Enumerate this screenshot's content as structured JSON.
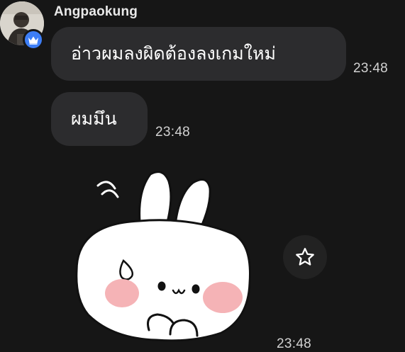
{
  "sender": {
    "name": "Angpaokung",
    "badge_icon": "crown-icon",
    "badge_color": "#3d7ef6"
  },
  "messages": [
    {
      "text": "อ่าวผมลงผิดต้องลงเกมใหม่",
      "time": "23:48"
    },
    {
      "text": "ผมมึน",
      "time": "23:48"
    }
  ],
  "sticker": {
    "icon": "bunny-sticker",
    "time": "23:48"
  },
  "actions": {
    "favorite_icon": "star-outline-icon"
  },
  "colors": {
    "background": "#161616",
    "bubble": "#2c2c2e",
    "badge": "#3d7ef6"
  }
}
